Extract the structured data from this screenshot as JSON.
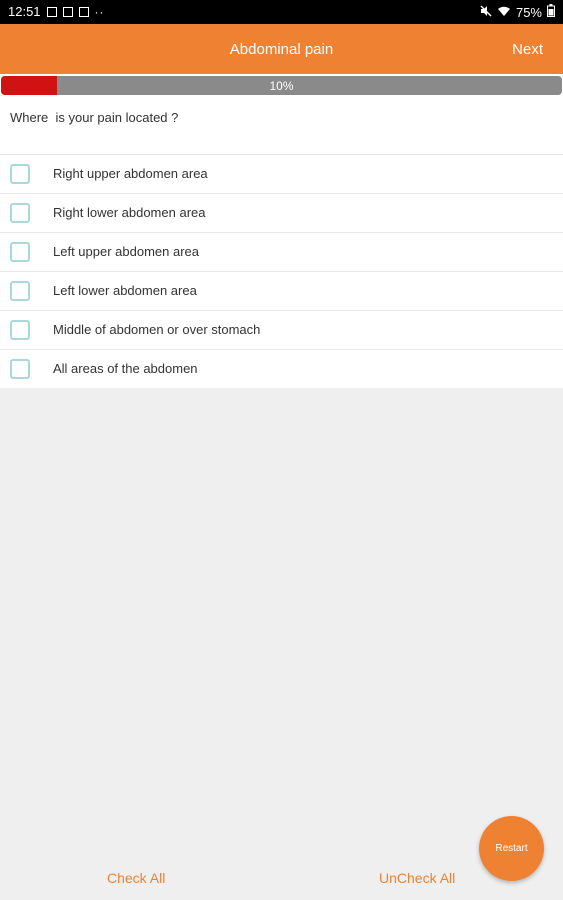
{
  "status_bar": {
    "time": "12:51",
    "battery": "75%",
    "more": "··"
  },
  "header": {
    "title": "Abdominal pain",
    "next_label": "Next"
  },
  "progress": {
    "text": "10%",
    "value": 0.1,
    "fill_color": "#d01212",
    "track_color": "#8a8a8a"
  },
  "question": {
    "text": "Where  is your pain located ?"
  },
  "options": [
    {
      "label": "Right upper abdomen area",
      "checked": false
    },
    {
      "label": "Right lower abdomen area",
      "checked": false
    },
    {
      "label": "Left upper abdomen area",
      "checked": false
    },
    {
      "label": "Left lower abdomen area",
      "checked": false
    },
    {
      "label": "Middle of abdomen or over stomach",
      "checked": false
    },
    {
      "label": "All areas of the abdomen",
      "checked": false
    }
  ],
  "footer": {
    "check_all_label": "Check All",
    "uncheck_all_label": "UnCheck All",
    "restart_label": "Restart"
  },
  "colors": {
    "accent": "#ef8232",
    "checkbox_border": "#a9d7db"
  }
}
